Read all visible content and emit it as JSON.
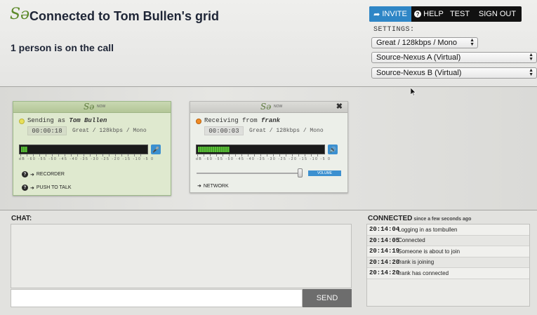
{
  "header": {
    "logo": "Sə",
    "title": "Connected to Tom Bullen's grid",
    "call_count": "1 person is on the call"
  },
  "nav": {
    "invite": "INVITE",
    "help": "HELP",
    "test": "TEST",
    "sign_out": "SIGN OUT"
  },
  "settings": {
    "label": "SETTINGS:",
    "quality": "Great / 128kbps / Mono",
    "source_a": "Source-Nexus A (Virtual)",
    "source_b": "Source-Nexus B (Virtual)"
  },
  "send_panel": {
    "logo": "Sə",
    "now": "NOW",
    "status_prefix": "Sending as",
    "user": "Tom Bullen",
    "timer": "00:00:18",
    "quality": "Great / 128kbps / Mono",
    "meter_level": 0.05,
    "scale": "dB -60 -55 -50 -45 -40 -35 -30 -25 -20 -15 -10 -5 0",
    "recorder_label": "RECORDER",
    "push_to_talk_label": "PUSH TO TALK",
    "mic_icon": "microphone-icon"
  },
  "recv_panel": {
    "logo": "Sə",
    "now": "NOW",
    "close": "✖",
    "status_prefix": "Receiving from",
    "user": "frank",
    "timer": "00:00:03",
    "quality": "Great / 128kbps / Mono",
    "meter_level": 0.25,
    "scale": "dB -60 -55 -50 -45 -40 -35 -30 -25 -20 -15 -10 -5 0",
    "volume_label": "VOLUME",
    "volume_level": 0.98,
    "network_label": "NETWORK",
    "speaker_icon": "speaker-icon"
  },
  "chat": {
    "label": "CHAT:",
    "input_value": "",
    "send_label": "SEND"
  },
  "connected": {
    "label": "CONNECTED",
    "subtitle": "since a few seconds ago",
    "log": [
      {
        "time": "20:14:04",
        "message": "Logging in as tombullen"
      },
      {
        "time": "20:14:05",
        "message": "Connected"
      },
      {
        "time": "20:14:19",
        "message": "Someone is about to join"
      },
      {
        "time": "20:14:20",
        "message": "frank is joining"
      },
      {
        "time": "20:14:20",
        "message": "frank has connected"
      }
    ]
  },
  "colors": {
    "accent": "#2f86c6",
    "brand_green": "#5d8a2a",
    "meter_green": "#5bbd3a",
    "sending_dot": "#e8e05a",
    "receiving_dot": "#f08a24"
  }
}
